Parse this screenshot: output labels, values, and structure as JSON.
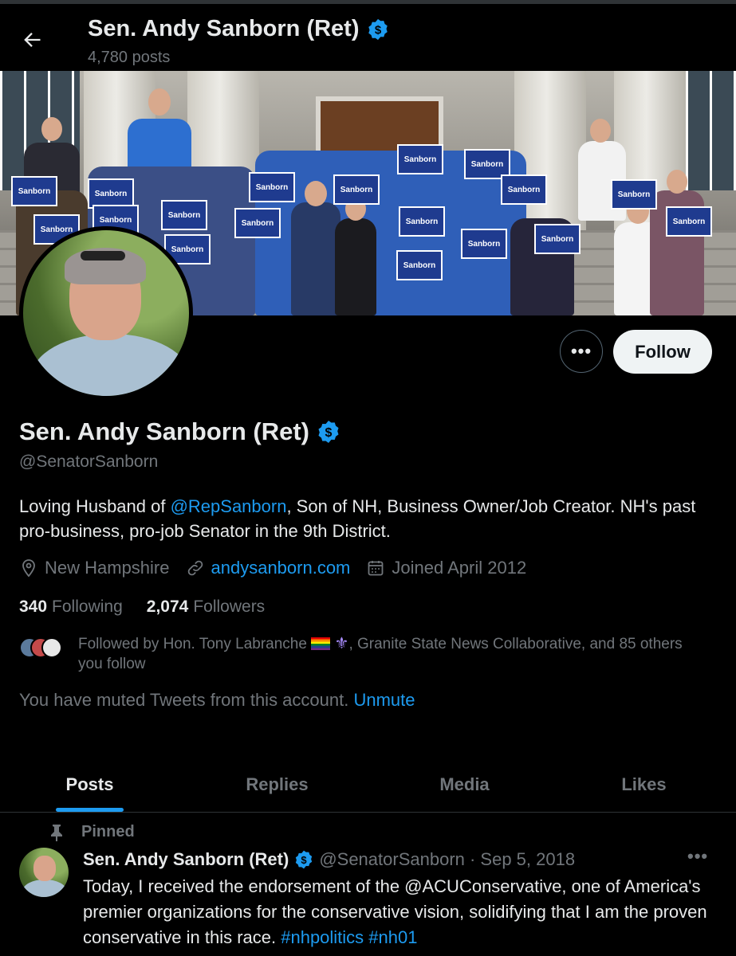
{
  "header": {
    "title": "Sen. Andy Sanborn (Ret)",
    "posts_count": "4,780 posts"
  },
  "banner": {
    "sign_text": "Sanborn"
  },
  "actions": {
    "more_label": "•••",
    "follow_label": "Follow"
  },
  "profile": {
    "name": "Sen. Andy Sanborn (Ret)",
    "handle": "@SenatorSanborn",
    "bio_prefix": "Loving Husband of ",
    "bio_mention": "@RepSanborn",
    "bio_suffix": ", Son of NH, Business Owner/Job Creator. NH's past pro-business, pro-job Senator in the 9th District.",
    "location": "New Hampshire",
    "website": "andysanborn.com",
    "joined": "Joined April 2012",
    "following_count": "340",
    "following_label": "Following",
    "followers_count": "2,074",
    "followers_label": "Followers",
    "followed_by_prefix": "Followed by Hon. Tony Labranche ",
    "followed_by_emoji2": "⚜",
    "followed_by_suffix": ", Granite State News Collaborative, and 85 others you follow",
    "muted_text": "You have muted Tweets from this account.",
    "unmute_label": "Unmute"
  },
  "tabs": [
    {
      "label": "Posts",
      "active": true
    },
    {
      "label": "Replies",
      "active": false
    },
    {
      "label": "Media",
      "active": false
    },
    {
      "label": "Likes",
      "active": false
    }
  ],
  "tweet": {
    "pinned_label": "Pinned",
    "author": "Sen. Andy Sanborn (Ret)",
    "handle_date": "@SenatorSanborn · Sep 5, 2018",
    "more_label": "•••",
    "text": "Today, I received the endorsement of the @ACUConservative, one of America's premier organizations for the conservative vision, solidifying that I am the proven conservative in this race. ",
    "hashtags": "#nhpolitics #nh01"
  },
  "colors": {
    "accent": "#1d9bf0",
    "background": "#000000",
    "secondary_text": "#71767b"
  }
}
